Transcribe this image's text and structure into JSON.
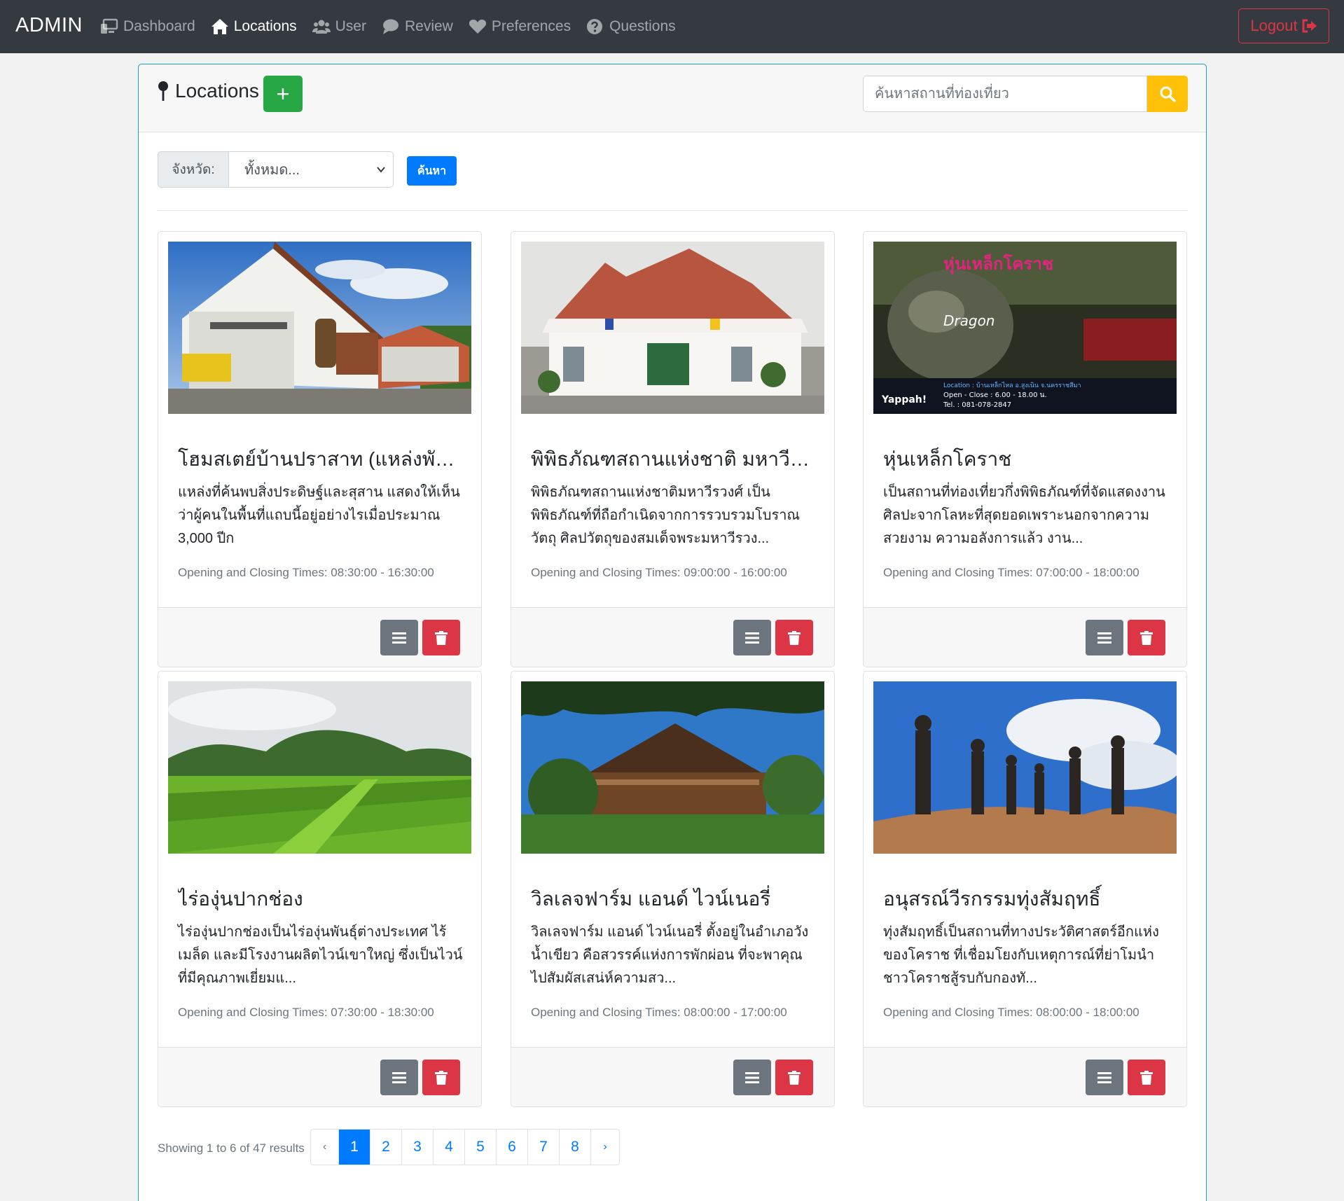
{
  "navbar": {
    "brand": "ADMIN",
    "items": [
      {
        "label": "Dashboard",
        "icon": "dashboard-icon",
        "active": false
      },
      {
        "label": "Locations",
        "icon": "home-icon",
        "active": true
      },
      {
        "label": "User",
        "icon": "users-icon",
        "active": false
      },
      {
        "label": "Review",
        "icon": "comment-icon",
        "active": false
      },
      {
        "label": "Preferences",
        "icon": "heart-icon",
        "active": false
      },
      {
        "label": "Questions",
        "icon": "question-circle-icon",
        "active": false
      }
    ],
    "logout_label": "Logout"
  },
  "header": {
    "title": "Locations",
    "add_label": "+",
    "search_placeholder": "ค้นหาสถานที่ท่องเที่ยว"
  },
  "filter": {
    "label": "จังหวัด:",
    "selected": "ทั้งหมด...",
    "button_label": "ค้นหา"
  },
  "cards": [
    {
      "title": "โฮมสเตย์บ้านปราสาท (แหล่งพักชุมชนบ้านปราสาท)",
      "text": "แหล่งที่ค้นพบสิ่งประดิษฐ์และสุสาน แสดงให้เห็นว่าผู้คนในพื้นที่แถบนี้อยู่อย่างไรเมื่อประมาณ 3,000 ปีก",
      "time": "Opening and Closing Times: 08:30:00 - 16:30:00"
    },
    {
      "title": "พิพิธภัณฑสถานแห่งชาติ มหาวีรวง",
      "text": "พิพิธภัณฑสถานแห่งชาติมหาวีรวงศ์ เป็นพิพิธภัณฑ์ที่ถือกำเนิดจากการรวบรวมโบราณวัตถุ ศิลปวัตถุของสมเด็จพระมหาวีรวง...",
      "time": "Opening and Closing Times: 09:00:00 - 16:00:00"
    },
    {
      "title": "หุ่นเหล็กโคราช",
      "text": "เป็นสถานที่ท่องเที่ยวกึ่งพิพิธภัณฑ์ที่จัดแสดงงานศิลปะจากโลหะที่สุดยอดเพราะนอกจากความสวยงาม ความอลังการแล้ว งาน...",
      "time": "Opening and Closing Times: 07:00:00 - 18:00:00",
      "image_text": {
        "top": "หุ่นเหล็กโคราช",
        "middle": "Dragon",
        "location": "Location : บ้านเหล็กไหล อ.สูงเนิน จ.นครราชสีมา",
        "hours": "Open - Close : 6.00 - 18.00 น.",
        "tel": "Tel. : 081-078-2847",
        "logo": "Yappah!"
      }
    },
    {
      "title": "ไร่องุ่นปากช่อง",
      "text": "ไร่องุ่นปากช่องเป็นไร่องุ่นพันธุ์ต่างประเทศ ไร้เมล็ด และมีโรงงานผลิตไวน์เขาใหญ่ ซึ่งเป็นไวน์ที่มีคุณภาพเยี่ยมแ...",
      "time": "Opening and Closing Times: 07:30:00 - 18:30:00"
    },
    {
      "title": "วิลเลจฟาร์ม แอนด์ ไวน์เนอรี่",
      "text": "วิลเลจฟาร์ม แอนด์ ไวน์เนอรี่ ตั้งอยู่ในอำเภอวังน้ำเขียว คือสวรรค์แห่งการพักผ่อน ที่จะพาคุณไปสัมผัสเสน่ห์ความสว...",
      "time": "Opening and Closing Times: 08:00:00 - 17:00:00"
    },
    {
      "title": "อนุสรณ์วีรกรรมทุ่งสัมฤทธิ์",
      "text": "ทุ่งสัมฤทธิ์เป็นสถานที่ทางประวัติศาสตร์อีกแห่งของโคราช ที่เชื่อมโยงกับเหตุการณ์ที่ย่าโมนำชาวโคราชสู้รบกับกองทั...",
      "time": "Opening and Closing Times: 08:00:00 - 18:00:00"
    }
  ],
  "pagination": {
    "showing": "Showing 1 to 6 of 47 results",
    "prev": "‹",
    "next": "›",
    "pages": [
      "1",
      "2",
      "3",
      "4",
      "5",
      "6",
      "7",
      "8"
    ],
    "current": "1"
  },
  "colors": {
    "navbar": "#343a40",
    "primary": "#007bff",
    "success": "#28a745",
    "danger": "#dc3545",
    "warning": "#ffc107",
    "secondary": "#6c757d",
    "panel_border": "#17a2b8"
  }
}
